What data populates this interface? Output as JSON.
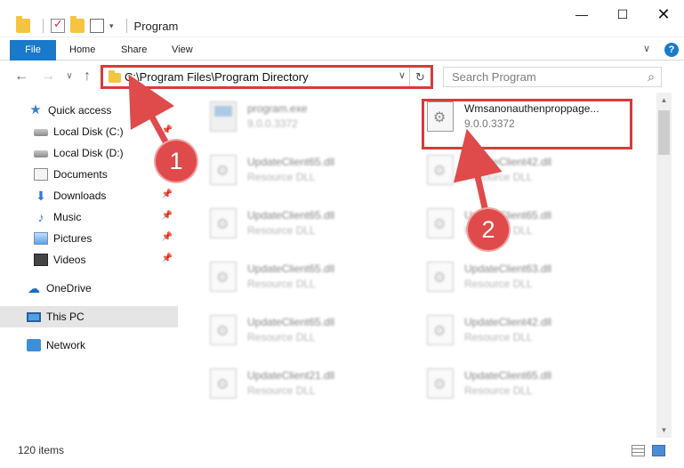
{
  "window": {
    "title": "Program",
    "controls": {
      "minimize": "—",
      "maximize": "☐",
      "close": "✕"
    }
  },
  "ribbon": {
    "tabs": [
      "File",
      "Home",
      "Share",
      "View"
    ],
    "expand_glyph": "∨",
    "help_glyph": "?"
  },
  "navigation": {
    "back": "←",
    "forward": "→",
    "recent": "∨",
    "up": "↑",
    "address_path": "C:\\Program Files\\Program Directory",
    "address_dropdown": "∨",
    "refresh_glyph": "↻",
    "search_placeholder": "Search Program",
    "search_glyph": "⌕"
  },
  "sidebar": {
    "items": [
      {
        "label": "Quick access",
        "icon": "star-icon",
        "pinned": false,
        "selected": false
      },
      {
        "label": "Local Disk (C:)",
        "icon": "drive-icon",
        "pinned": true,
        "selected": false
      },
      {
        "label": "Local Disk (D:)",
        "icon": "drive-icon",
        "pinned": false,
        "selected": false
      },
      {
        "label": "Documents",
        "icon": "documents-icon",
        "pinned": true,
        "selected": false
      },
      {
        "label": "Downloads",
        "icon": "download-icon",
        "pinned": true,
        "selected": false
      },
      {
        "label": "Music",
        "icon": "music-icon",
        "pinned": true,
        "selected": false
      },
      {
        "label": "Pictures",
        "icon": "pictures-icon",
        "pinned": true,
        "selected": false
      },
      {
        "label": "Videos",
        "icon": "videos-icon",
        "pinned": true,
        "selected": false
      },
      {
        "label": "OneDrive",
        "icon": "onedrive-icon",
        "pinned": false,
        "selected": false
      },
      {
        "label": "This PC",
        "icon": "this-pc-icon",
        "pinned": false,
        "selected": true
      },
      {
        "label": "Network",
        "icon": "network-icon",
        "pinned": false,
        "selected": false
      }
    ],
    "pin_glyph": "📌"
  },
  "files": [
    {
      "name": "program.exe",
      "sub": "9.0.0.3372",
      "type": "exe",
      "blurred": true
    },
    {
      "name": "Wmsanonauthenproppage...",
      "sub": "9.0.0.3372",
      "type": "dll",
      "blurred": false,
      "highlighted": true
    },
    {
      "name": "UpdateClient65.dll",
      "sub": "Resource DLL",
      "type": "dll",
      "blurred": true
    },
    {
      "name": "UpdateClient42.dll",
      "sub": "Resource DLL",
      "type": "dll",
      "blurred": true
    },
    {
      "name": "UpdateClient65.dll",
      "sub": "Resource DLL",
      "type": "dll",
      "blurred": true
    },
    {
      "name": "UpdateClient65.dll",
      "sub": "Resource DLL",
      "type": "dll",
      "blurred": true
    },
    {
      "name": "UpdateClient65.dll",
      "sub": "Resource DLL",
      "type": "dll",
      "blurred": true
    },
    {
      "name": "UpdateClient63.dll",
      "sub": "Resource DLL",
      "type": "dll",
      "blurred": true
    },
    {
      "name": "UpdateClient65.dll",
      "sub": "Resource DLL",
      "type": "dll",
      "blurred": true
    },
    {
      "name": "UpdateClient42.dll",
      "sub": "Resource DLL",
      "type": "dll",
      "blurred": true
    },
    {
      "name": "UpdateClient21.dll",
      "sub": "Resource DLL",
      "type": "dll",
      "blurred": true
    },
    {
      "name": "UpdateClient65.dll",
      "sub": "Resource DLL",
      "type": "dll",
      "blurred": true
    }
  ],
  "status": {
    "item_count": "120 items"
  },
  "callouts": {
    "step1": "1",
    "step2": "2",
    "accent": "#df4a4a"
  },
  "colors": {
    "file_tab": "#1979ca",
    "highlight_border": "#d93a3a",
    "selected_sidebar": "#e5e5e5"
  }
}
